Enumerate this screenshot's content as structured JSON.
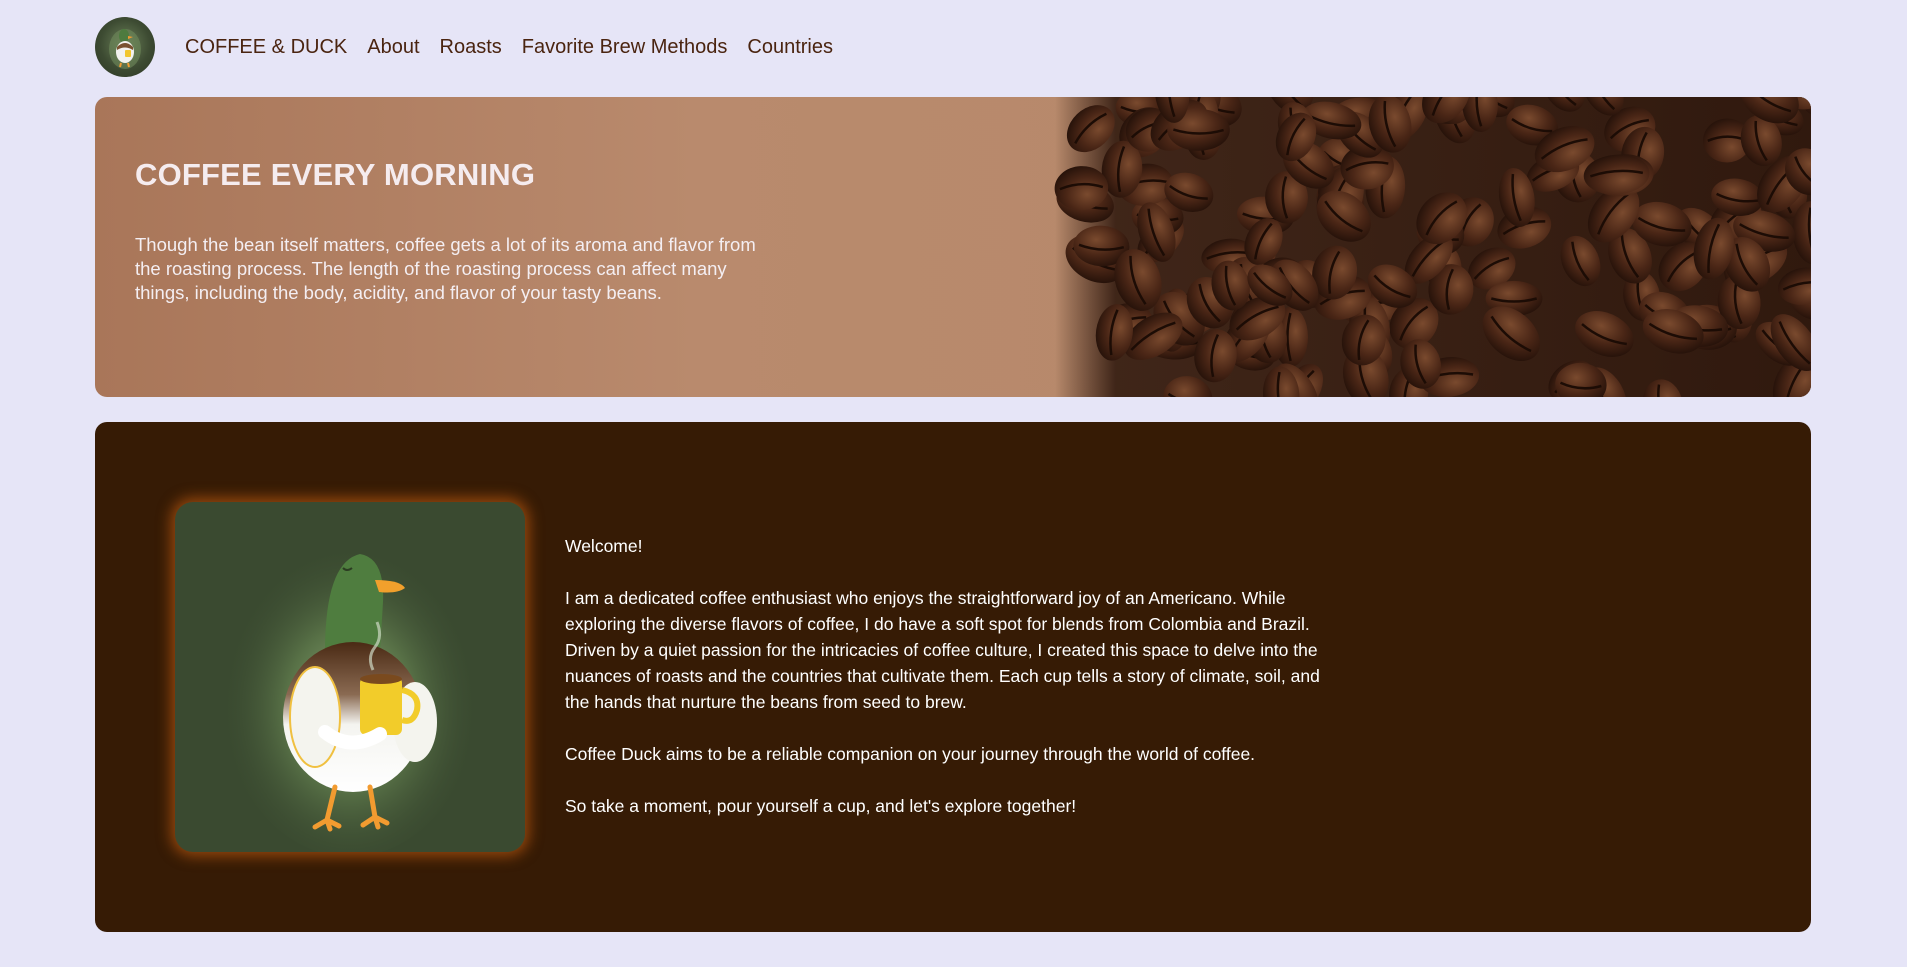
{
  "nav": {
    "brand": "COFFEE & DUCK",
    "links": [
      "About",
      "Roasts",
      "Favorite Brew Methods",
      "Countries"
    ],
    "logo_icon": "duck-with-coffee-logo"
  },
  "hero": {
    "title": "COFFEE EVERY MORNING",
    "text": "Though the bean itself matters, coffee gets a lot of its aroma and flavor from the roasting process. The length of the roasting process can affect many things, including the body, acidity, and flavor of your tasty beans."
  },
  "about": {
    "image": "duck-holding-coffee-mug",
    "greeting": "Welcome!",
    "paragraph1": "I am a dedicated coffee enthusiast who enjoys the straightforward joy of an Americano. While exploring the diverse flavors of coffee, I do have a soft spot for blends from Colombia and Brazil. Driven by a quiet passion for the intricacies of coffee culture, I created this space to delve into the nuances of roasts and the countries that cultivate them. Each cup tells a story of climate, soil, and the hands that nurture the beans from seed to brew.",
    "paragraph2": "Coffee Duck aims to be a reliable companion on your journey through the world of coffee.",
    "paragraph3": "So take a moment, pour yourself a cup, and let's explore together!"
  },
  "colors": {
    "page_bg": "#e6e5f7",
    "nav_text": "#4a2410",
    "about_bg": "#361b05",
    "duck_card_bg": "#3a4a30",
    "card_glow": "#e66e14"
  }
}
